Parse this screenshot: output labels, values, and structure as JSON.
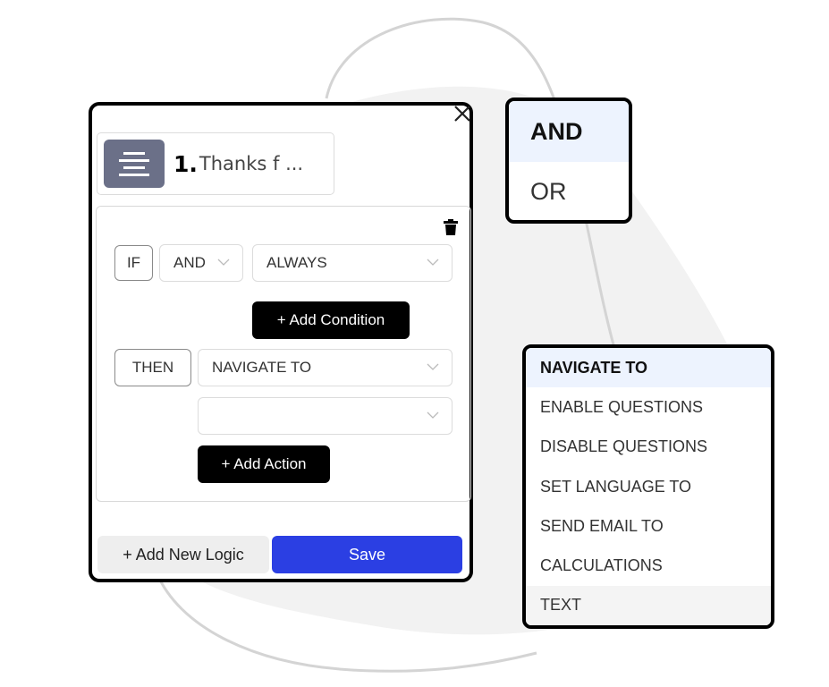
{
  "panel": {
    "question": {
      "number": "1.",
      "title": "Thanks f ..."
    },
    "condition": {
      "if_label": "IF",
      "operator": "AND",
      "condition_value": "ALWAYS",
      "add_condition_label": "+ Add Condition"
    },
    "action": {
      "then_label": "THEN",
      "action_value": "NAVIGATE TO",
      "target_value": "",
      "add_action_label": "+ Add Action"
    },
    "add_new_logic_label": "+ Add New Logic",
    "save_label": "Save"
  },
  "operator_dropdown": {
    "items": [
      {
        "label": "AND",
        "selected": true
      },
      {
        "label": "OR",
        "selected": false
      }
    ]
  },
  "action_dropdown": {
    "items": [
      {
        "label": "NAVIGATE TO",
        "selected": true
      },
      {
        "label": "ENABLE QUESTIONS",
        "selected": false
      },
      {
        "label": "DISABLE QUESTIONS",
        "selected": false
      },
      {
        "label": "SET LANGUAGE TO",
        "selected": false
      },
      {
        "label": "SEND EMAIL TO",
        "selected": false
      },
      {
        "label": "CALCULATIONS",
        "selected": false
      },
      {
        "label": "TEXT",
        "selected": false,
        "hovered": true
      }
    ]
  },
  "colors": {
    "save_button": "#2b3fe3",
    "question_icon": "#6b7088",
    "selected_item_bg": "#edf3fe",
    "background_blob": "#f2f2f2"
  }
}
